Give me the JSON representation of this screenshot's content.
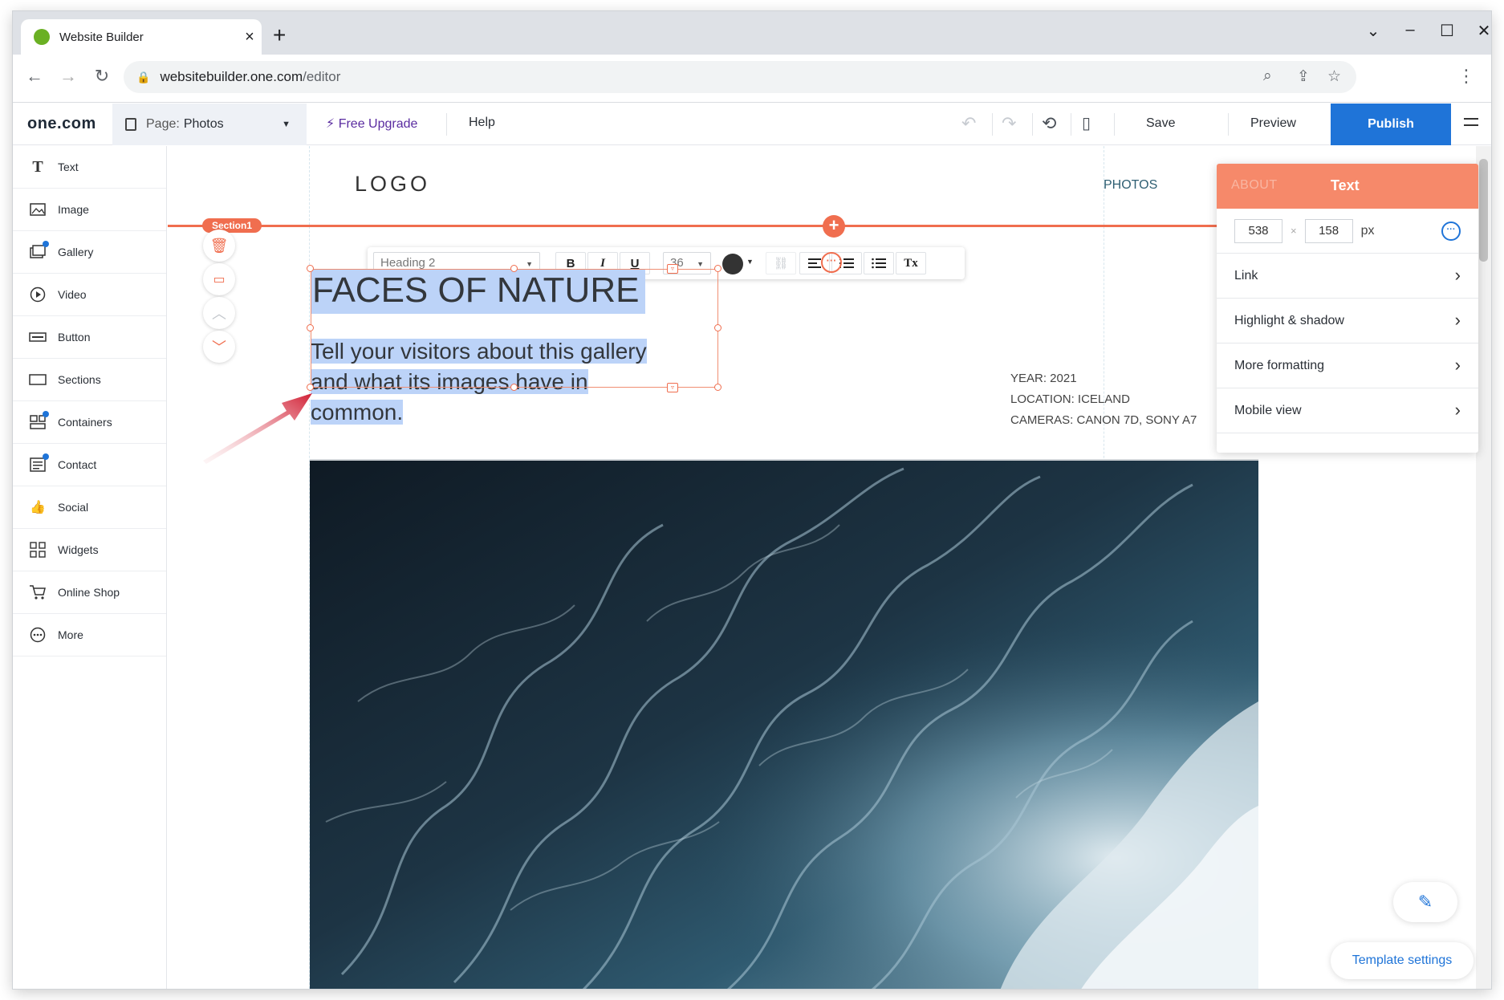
{
  "browser": {
    "tab_title": "Website Builder",
    "tab_close": "×",
    "new_tab": "+",
    "url_host": "websitebuilder.one.com",
    "url_path": "/editor",
    "window_controls": [
      "⌄",
      "–",
      "☐",
      "✕"
    ]
  },
  "editor": {
    "brand": "one.com",
    "page_label": "Page:",
    "page_value": "Photos",
    "free_upgrade": "Free Upgrade",
    "help": "Help",
    "save": "Save",
    "preview": "Preview",
    "publish": "Publish"
  },
  "sidebar": {
    "items": [
      {
        "label": "Text",
        "icon": "text-icon"
      },
      {
        "label": "Image",
        "icon": "image-icon"
      },
      {
        "label": "Gallery",
        "icon": "gallery-icon"
      },
      {
        "label": "Video",
        "icon": "video-icon"
      },
      {
        "label": "Button",
        "icon": "button-icon"
      },
      {
        "label": "Sections",
        "icon": "sections-icon"
      },
      {
        "label": "Containers",
        "icon": "containers-icon"
      },
      {
        "label": "Contact",
        "icon": "contact-icon"
      },
      {
        "label": "Social",
        "icon": "social-icon"
      },
      {
        "label": "Widgets",
        "icon": "widgets-icon"
      },
      {
        "label": "Online Shop",
        "icon": "cart-icon"
      },
      {
        "label": "More",
        "icon": "more-icon"
      }
    ]
  },
  "canvas": {
    "logo": "LOGO",
    "nav_photos": "PHOTOS",
    "section_tag": "Section1",
    "heading": "FACES OF NATURE",
    "paragraph": "Tell your visitors about this gallery and what its images have in common.",
    "info_year": "YEAR: 2021",
    "info_location": "LOCATION: ICELAND",
    "info_cameras": "CAMERAS: CANON 7D, SONY A7"
  },
  "format_toolbar": {
    "style_value": "Heading 2",
    "font_size": "36",
    "bold": "B",
    "italic": "I",
    "underline": "U",
    "clear": "Tx",
    "text_color": "#333333"
  },
  "panel": {
    "ghost_tab": "ABOUT",
    "title": "Text",
    "width": "538",
    "height": "158",
    "unit": "px",
    "rows": [
      "Link",
      "Highlight & shadow",
      "More formatting",
      "Mobile view"
    ]
  },
  "template_settings": "Template settings",
  "colors": {
    "accent": "#f06e4f",
    "publish": "#1f74d8",
    "selection": "#bcd3f8"
  }
}
